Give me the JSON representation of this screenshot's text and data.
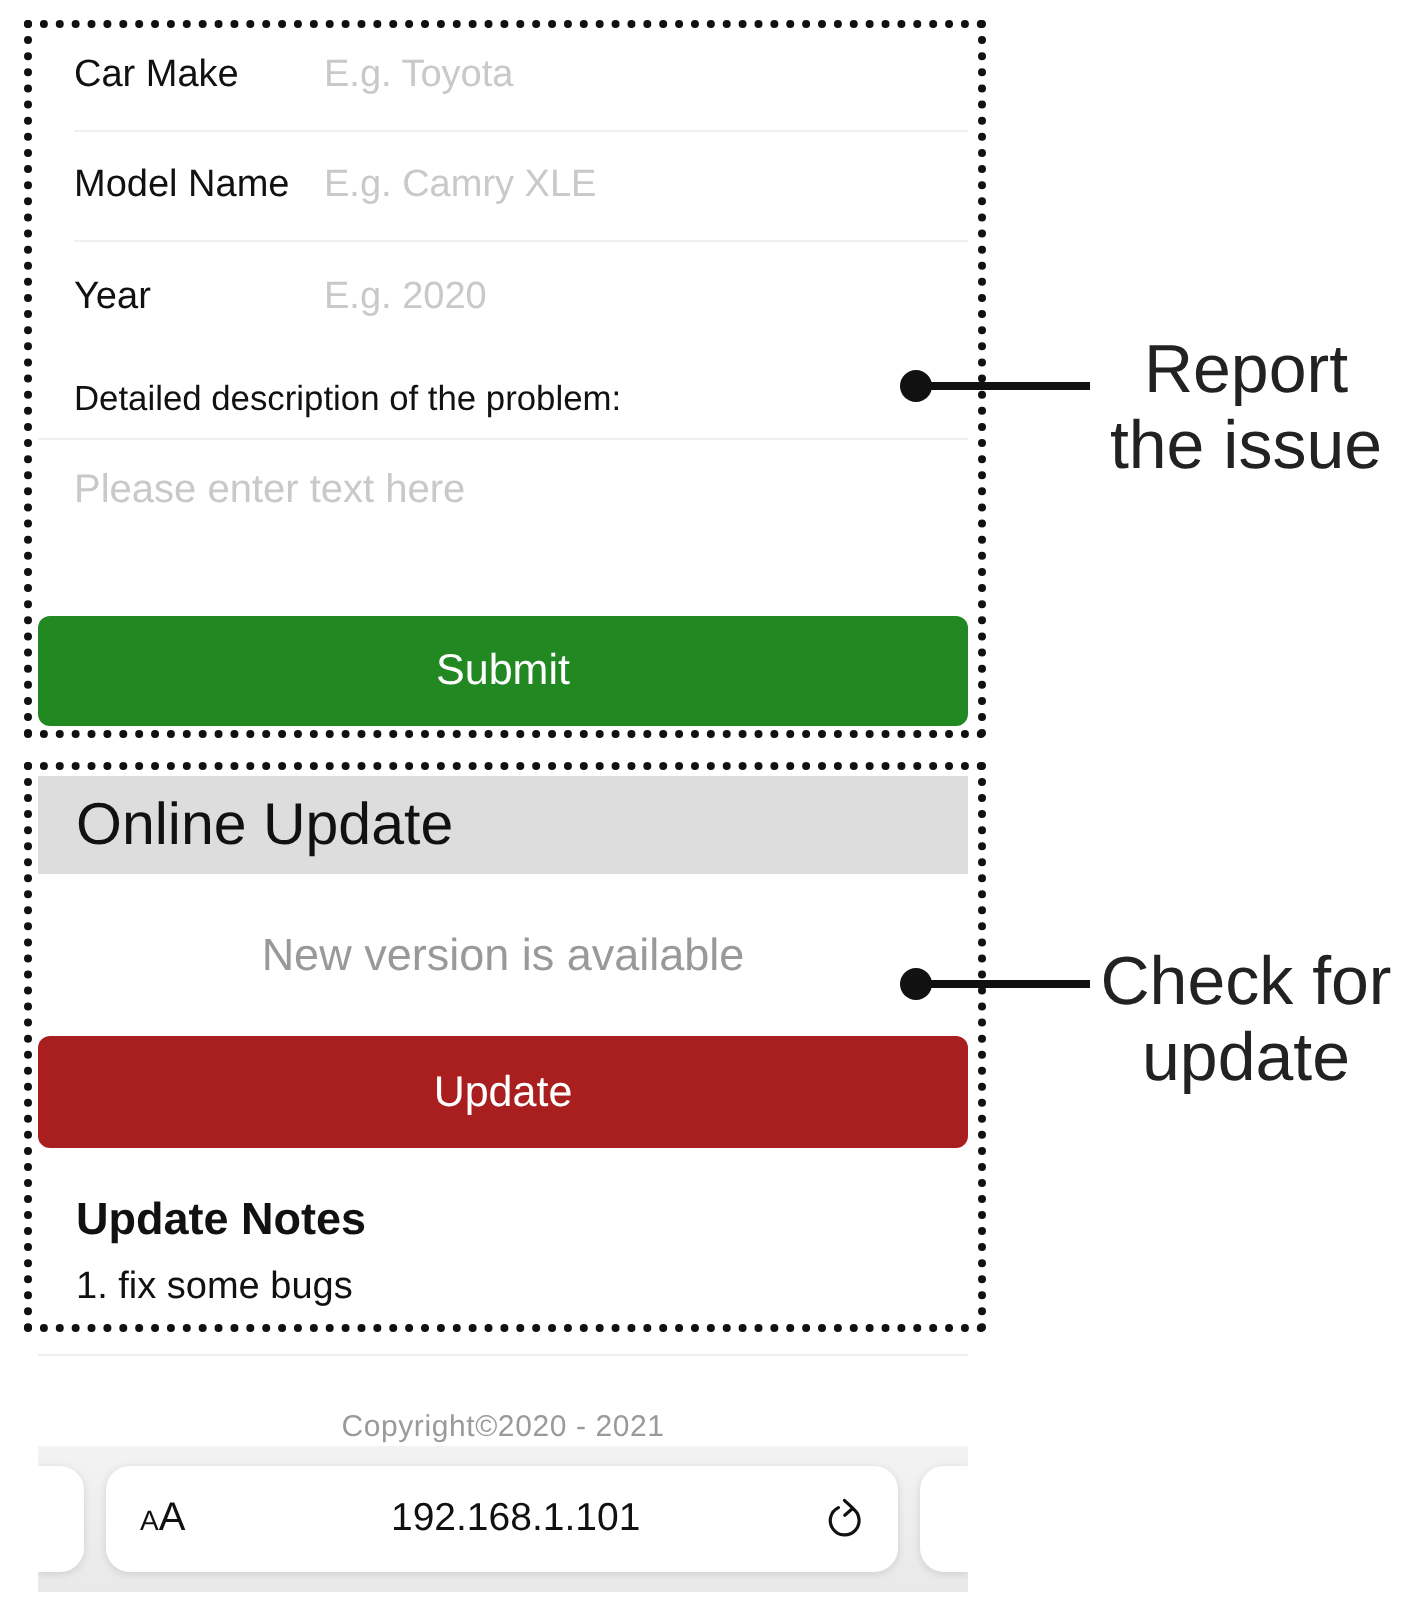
{
  "form": {
    "fields": [
      {
        "label": "Car Make",
        "placeholder": "E.g. Toyota"
      },
      {
        "label": "Model Name",
        "placeholder": "E.g. Camry XLE"
      },
      {
        "label": "Year",
        "placeholder": "E.g. 2020"
      }
    ],
    "description": {
      "label": "Detailed description of the problem:",
      "placeholder": "Please enter text here"
    },
    "submit_button": "Submit"
  },
  "update": {
    "title": "Online Update",
    "status": "New version is available",
    "update_button": "Update",
    "notes_title": "Update Notes",
    "notes": [
      "1. fix some bugs"
    ]
  },
  "footer": {
    "copyright": "Copyright©2020 - 2021"
  },
  "browser_bar": {
    "text_size_button": "AA",
    "address": "192.168.1.101"
  },
  "callouts": [
    {
      "label": "Report the issue"
    },
    {
      "label": "Check for update"
    }
  ]
}
